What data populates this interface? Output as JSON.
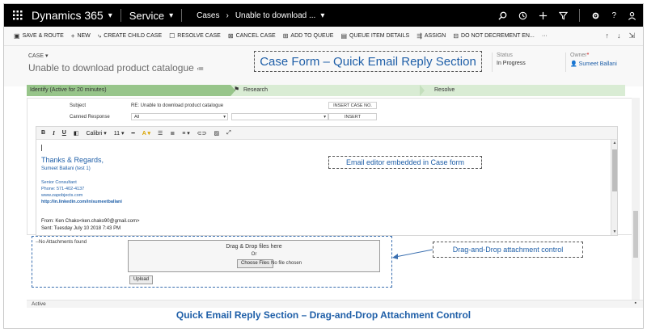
{
  "nav": {
    "brand": "Dynamics 365",
    "area": "Service",
    "crumb1": "Cases",
    "crumb2": "Unable to download ...",
    "icons": [
      "search-icon",
      "history-icon",
      "plus-icon",
      "filter-icon",
      "gear-icon",
      "help-icon",
      "user-icon"
    ]
  },
  "commands": [
    {
      "label": "SAVE & ROUTE",
      "icon": "save-route-icon",
      "glyph": "▣"
    },
    {
      "label": "NEW",
      "icon": "plus-icon",
      "glyph": "+"
    },
    {
      "label": "CREATE CHILD CASE",
      "icon": "child-case-icon",
      "glyph": "⤷"
    },
    {
      "label": "RESOLVE CASE",
      "icon": "resolve-icon",
      "glyph": "☐"
    },
    {
      "label": "CANCEL CASE",
      "icon": "cancel-icon",
      "glyph": "⊠"
    },
    {
      "label": "ADD TO QUEUE",
      "icon": "queue-icon",
      "glyph": "⊞"
    },
    {
      "label": "QUEUE ITEM DETAILS",
      "icon": "queue-details-icon",
      "glyph": "▤"
    },
    {
      "label": "ASSIGN",
      "icon": "assign-icon",
      "glyph": "⇶"
    },
    {
      "label": "DO NOT DECREMENT EN...",
      "icon": "decrement-icon",
      "glyph": "⊟"
    },
    {
      "label": "···",
      "icon": "more-icon",
      "glyph": ""
    }
  ],
  "header": {
    "entity": "CASE ▾",
    "title": "Unable to download product catalogue",
    "status_label": "Status",
    "status_value": "In Progress",
    "owner_label": "Owner",
    "owner_value": "Sumeet Ballani",
    "callout": "Case Form – Quick Email Reply Section"
  },
  "process": {
    "active": "Identify (Active for 20 minutes)",
    "stage2": "Research",
    "stage3": "Resolve"
  },
  "email": {
    "subject_label": "Subject",
    "subject_value": "RE: Unable to download product catalogue",
    "insert_case_no": "INSERT CASE NO.",
    "canned_label": "Canned Response",
    "canned_value": "All",
    "insert": "INSERT"
  },
  "editor": {
    "font": "Calibri",
    "size": "11",
    "thanks": "Thanks & Regards,",
    "name": "Sumeet Ballani (test 1)",
    "role": "Senior Consultant",
    "phone": "Phone: 571-402-4137",
    "site": "www.zapobjects.com",
    "linkedin": "http://in.linkedin.com/in/sumeetballani",
    "from": "From: Ken Chako<ken.chako90@gmail.com>",
    "sent": "Sent: Tuesday July 10 2018 7:43 PM",
    "callout": "Email editor embedded in Case form"
  },
  "attachments": {
    "none": "--No Attachments found",
    "drag": "Drag & Drop files here",
    "or": "Or",
    "choose": "Choose Files",
    "nofile": "No file chosen",
    "upload": "Upload",
    "callout": "Drag-and-Drop attachment control"
  },
  "status": {
    "text": "Active"
  },
  "caption": "Quick Email Reply Section – Drag-and-Drop Attachment Control",
  "colors": {
    "accent": "#1f5fa8",
    "process_active": "#97c58a",
    "process_bg": "#d9ecd4"
  }
}
